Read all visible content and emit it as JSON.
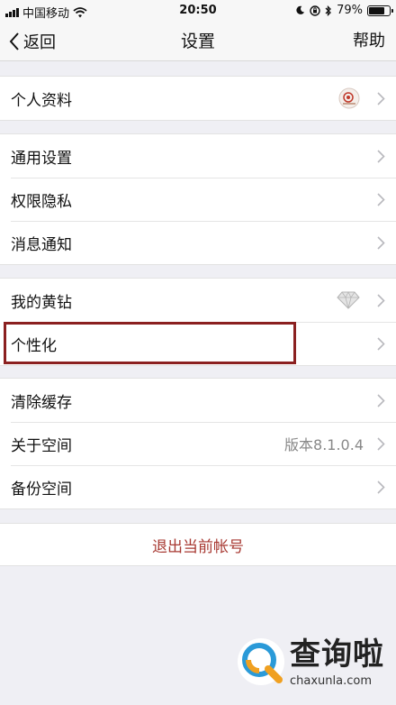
{
  "status_bar": {
    "carrier": "中国移动",
    "time": "20:50",
    "battery_percent": "79%",
    "battery_level": 0.79
  },
  "nav": {
    "back_label": "返回",
    "title": "设置",
    "help_label": "帮助"
  },
  "groups": [
    {
      "rows": [
        {
          "label": "个人资料",
          "icon": "profile-avatar-icon"
        }
      ]
    },
    {
      "rows": [
        {
          "label": "通用设置"
        },
        {
          "label": "权限隐私"
        },
        {
          "label": "消息通知"
        }
      ]
    },
    {
      "rows": [
        {
          "label": "我的黄钻",
          "icon": "diamond-icon"
        },
        {
          "label": "个性化",
          "highlighted": true
        }
      ]
    },
    {
      "rows": [
        {
          "label": "清除缓存"
        },
        {
          "label": "关于空间",
          "value": "版本8.1.0.4"
        },
        {
          "label": "备份空间"
        }
      ]
    }
  ],
  "logout_label": "退出当前帐号",
  "watermark": {
    "text_cn": "查询啦",
    "text_en": "chaxunla.com"
  },
  "colors": {
    "background": "#efeff4",
    "logout_text": "#a83a33",
    "highlight_border": "#8b2020"
  }
}
